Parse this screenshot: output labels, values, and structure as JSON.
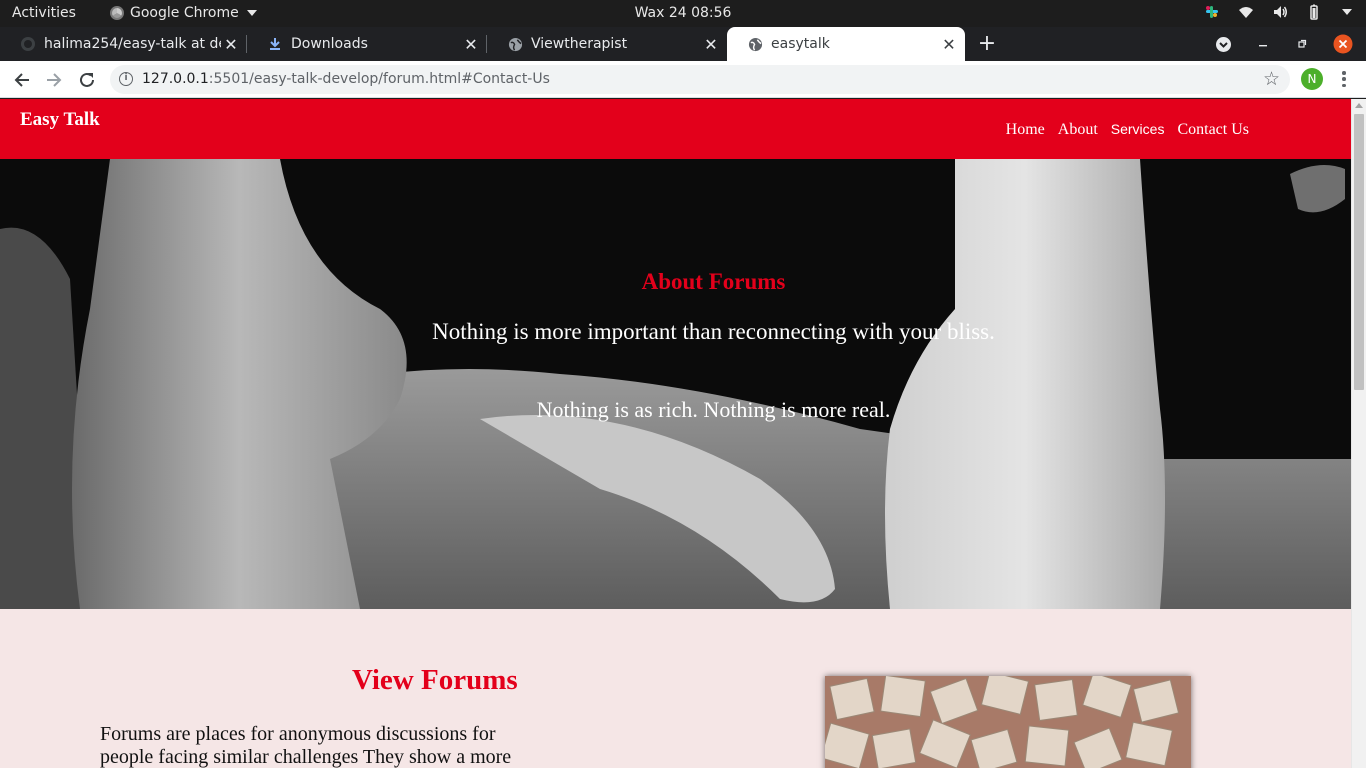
{
  "os": {
    "activities": "Activities",
    "app_name": "Google Chrome",
    "clock": "Wax 24  08:56"
  },
  "tabs": [
    {
      "title": "halima254/easy-talk at de",
      "favicon": "github-icon"
    },
    {
      "title": "Downloads",
      "favicon": "download-icon"
    },
    {
      "title": "Viewtherapist",
      "favicon": "globe-icon"
    },
    {
      "title": "easytalk",
      "favicon": "globe-icon",
      "active": true
    }
  ],
  "address": {
    "host": "127.0.0.1",
    "rest": ":5501/easy-talk-develop/forum.html#Contact-Us"
  },
  "profile_initial": "N",
  "site": {
    "brand": "Easy Talk",
    "nav": {
      "home": "Home",
      "about": "About",
      "services": "Services",
      "contact": "Contact Us"
    },
    "hero": {
      "title": "About Forums",
      "line1": "Nothing is more important than reconnecting with your bliss.",
      "line2": "Nothing is as rich. Nothing is more real."
    },
    "forums": {
      "heading": "View Forums",
      "body": "Forums are places for anonymous discussions for people facing similar challenges They show a more"
    }
  },
  "colors": {
    "brand_red": "#e3001b",
    "section_bg": "#f5e6e6",
    "chrome_dark": "#202124"
  }
}
